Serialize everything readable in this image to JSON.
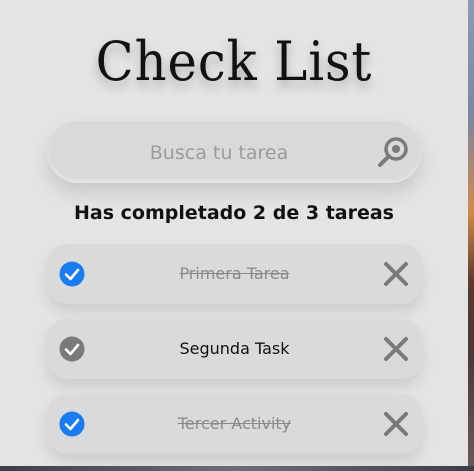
{
  "app": {
    "title": "Check List"
  },
  "search": {
    "placeholder": "Busca tu tarea",
    "value": "",
    "icon": "search-icon"
  },
  "summary": {
    "text": "Has completado 2 de 3 tareas",
    "completed": 2,
    "total": 3
  },
  "todos": [
    {
      "text": "Primera Tarea",
      "completed": true
    },
    {
      "text": "Segunda Task",
      "completed": false
    },
    {
      "text": "Tercer Activity",
      "completed": true
    }
  ],
  "colors": {
    "check_active": "#1a7cf2",
    "check_inactive": "#7a7a7a",
    "delete": "#7a7a7a"
  }
}
